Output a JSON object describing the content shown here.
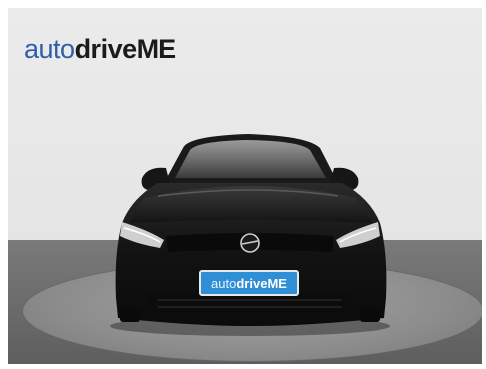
{
  "logo": {
    "part1": "auto",
    "part2": "drive",
    "part3": "ME",
    "accent_color": "#2f5ea8",
    "dark_color": "#1b1b1b"
  },
  "plate": {
    "part1": "auto",
    "part2": "drive",
    "part3": "ME",
    "background": "#2f8fd6"
  },
  "scene": {
    "car_color": "#141414",
    "wall_color": "#e8e8e8",
    "floor_color": "#8c8c8c"
  }
}
